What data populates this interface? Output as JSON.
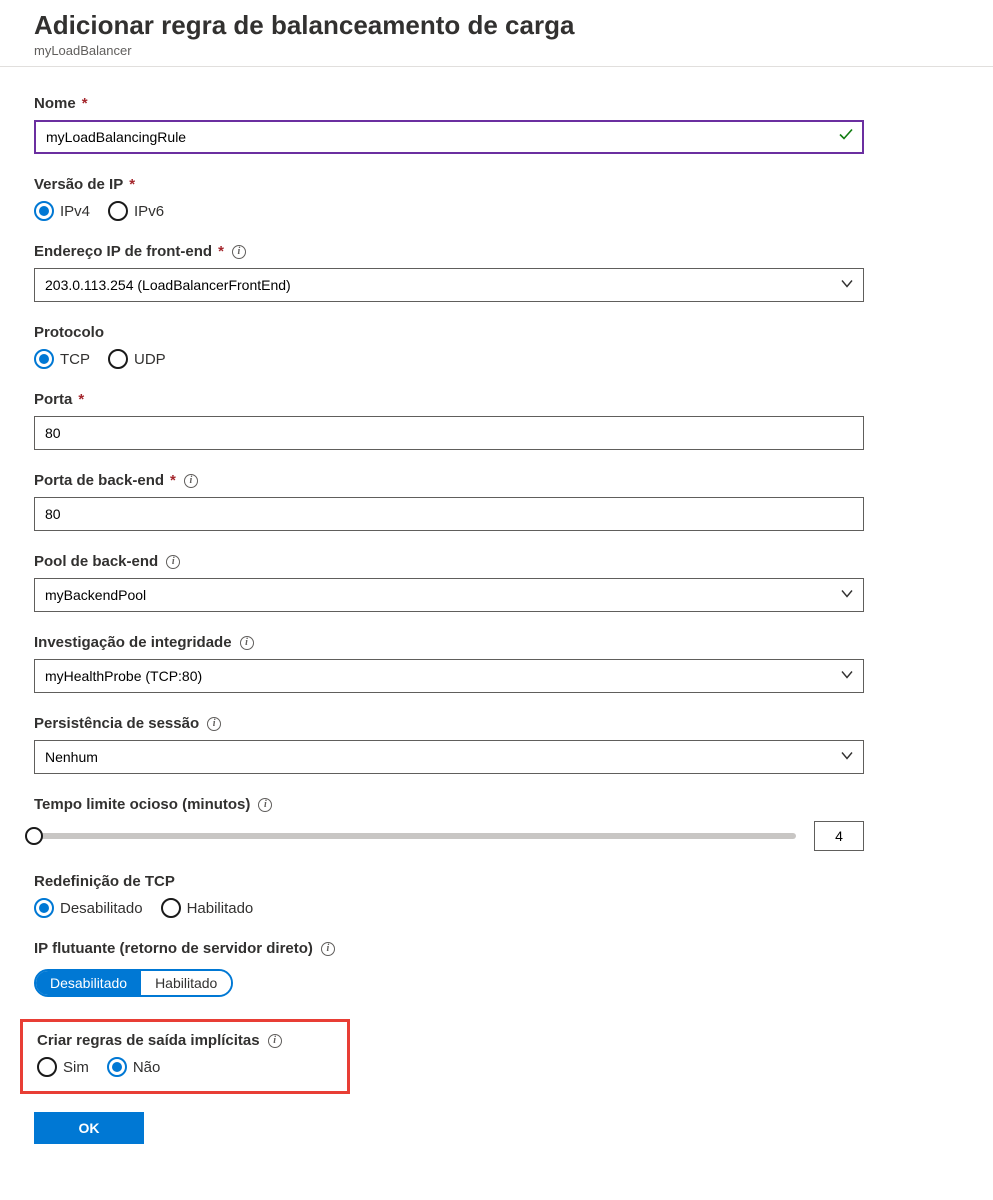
{
  "header": {
    "title": "Adicionar regra de balanceamento de carga",
    "subtitle": "myLoadBalancer"
  },
  "fields": {
    "name": {
      "label": "Nome",
      "value": "myLoadBalancingRule"
    },
    "ip_version": {
      "label": "Versão de IP",
      "options": {
        "ipv4": "IPv4",
        "ipv6": "IPv6"
      },
      "selected": "ipv4"
    },
    "frontend_ip": {
      "label": "Endereço IP de front-end",
      "value": "203.0.113.254 (LoadBalancerFrontEnd)"
    },
    "protocol": {
      "label": "Protocolo",
      "options": {
        "tcp": "TCP",
        "udp": "UDP"
      },
      "selected": "tcp"
    },
    "port": {
      "label": "Porta",
      "value": "80"
    },
    "backend_port": {
      "label": "Porta de back-end",
      "value": "80"
    },
    "backend_pool": {
      "label": "Pool de back-end",
      "value": "myBackendPool"
    },
    "health_probe": {
      "label": "Investigação de integridade",
      "value": "myHealthProbe (TCP:80)"
    },
    "session_persistence": {
      "label": "Persistência de sessão",
      "value": "Nenhum"
    },
    "idle_timeout": {
      "label": "Tempo limite ocioso (minutos)",
      "value": "4"
    },
    "tcp_reset": {
      "label": "Redefinição de TCP",
      "options": {
        "disabled": "Desabilitado",
        "enabled": "Habilitado"
      },
      "selected": "disabled"
    },
    "floating_ip": {
      "label": "IP flutuante (retorno de servidor direto)",
      "options": {
        "disabled": "Desabilitado",
        "enabled": "Habilitado"
      },
      "selected": "disabled"
    },
    "implicit_outbound": {
      "label": "Criar regras de saída implícitas",
      "options": {
        "yes": "Sim",
        "no": "Não"
      },
      "selected": "no"
    }
  },
  "footer": {
    "ok": "OK"
  }
}
